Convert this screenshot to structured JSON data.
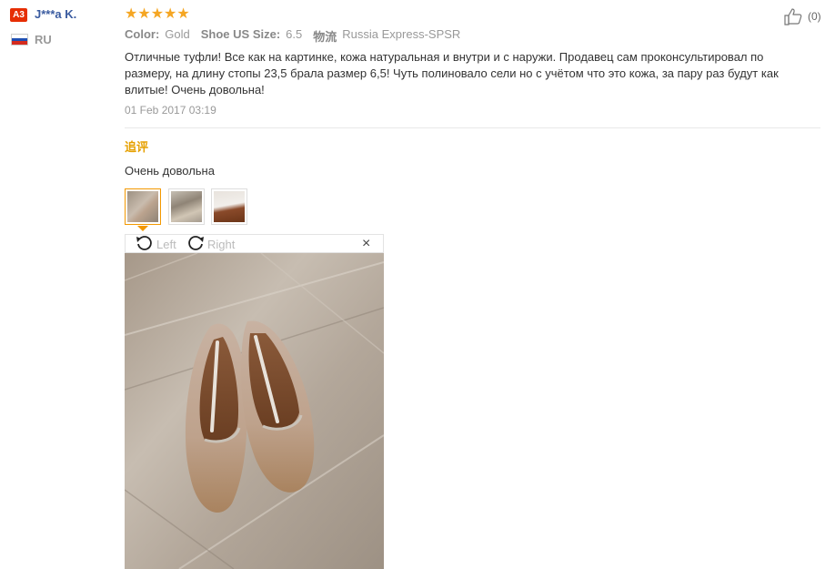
{
  "reviewer": {
    "level_badge": "A3",
    "name": "J***a K.",
    "country": "RU"
  },
  "rating": {
    "stars": 5,
    "max": 5,
    "color": "#f5a623"
  },
  "helpful": {
    "count_label": "(0)"
  },
  "meta": {
    "color_key": "Color:",
    "color_value": "Gold",
    "size_key": "Shoe US Size:",
    "size_value": "6.5",
    "shipping_key": "物流",
    "shipping_value": "Russia Express-SPSR"
  },
  "review": {
    "text": "Отличные туфли! Все как на картинке, кожа натуральная и внутри и с наружи. Продавец сам проконсультировал по размеру, на длину стопы 23,5 брала размер 6,5! Чуть полиновало сели но с учётом что это кожа, за пару раз будут как влитые! Очень довольна!",
    "date": "01 Feb 2017 03:19"
  },
  "followup": {
    "label": "追评",
    "text": "Очень довольна"
  },
  "thumbnails": [
    {
      "name": "photo-1",
      "active": true
    },
    {
      "name": "photo-2",
      "active": false
    },
    {
      "name": "photo-3",
      "active": false
    }
  ],
  "viewer": {
    "rotate_left": "Left",
    "rotate_right": "Right",
    "close": "×"
  },
  "colors": {
    "accent": "#f39800",
    "username": "#3a5ba0",
    "badge": "#e62e04",
    "followup": "#e6a000"
  }
}
